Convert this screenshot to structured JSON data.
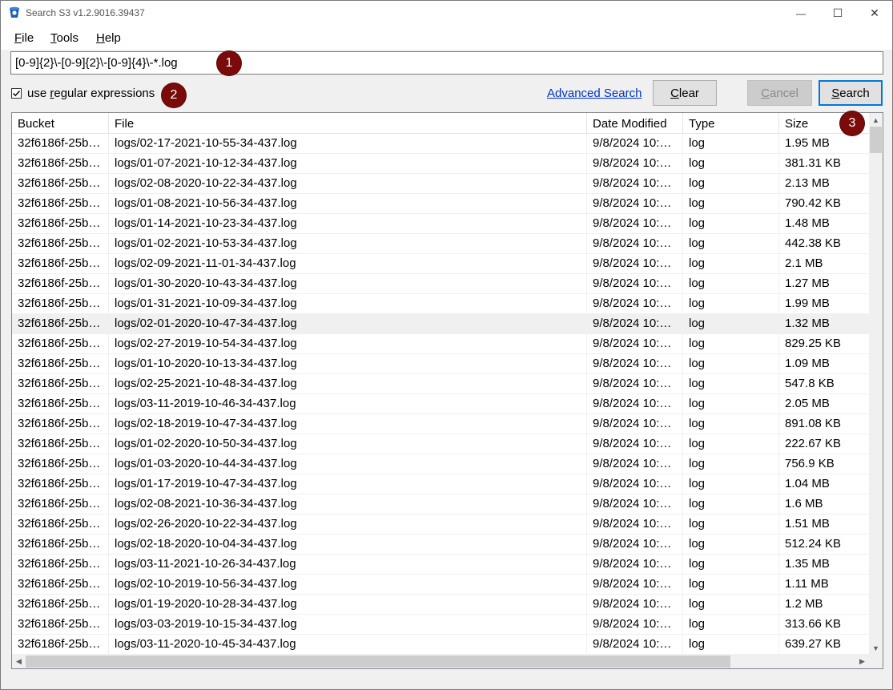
{
  "window": {
    "title": "Search S3 v1.2.9016.39437",
    "minimize_glyph": "—",
    "maximize_glyph": "☐",
    "close_glyph": "✕"
  },
  "menu": {
    "file_u": "F",
    "file_rest": "ile",
    "tools_u": "T",
    "tools_rest": "ools",
    "help_u": "H",
    "help_rest": "elp"
  },
  "search": {
    "query": "[0-9]{2}\\-[0-9]{2}\\-[0-9]{4}\\-*.log"
  },
  "badges": {
    "one": "1",
    "two": "2",
    "three": "3"
  },
  "options": {
    "regex_checked": true,
    "regex_label_pre": "use ",
    "regex_label_u": "r",
    "regex_label_post": "egular expressions",
    "advanced_link": "Advanced Search"
  },
  "buttons": {
    "clear_u": "C",
    "clear_rest": "lear",
    "cancel_u": "C",
    "cancel_rest": "ancel",
    "search_u": "S",
    "search_rest": "earch"
  },
  "table": {
    "columns": [
      "Bucket",
      "File",
      "Date Modified",
      "Type",
      "Size"
    ],
    "highlight_row": 9,
    "rows": [
      [
        "32f6186f-25b…",
        "logs/02-17-2021-10-55-34-437.log",
        "9/8/2024 10:…",
        "log",
        "1.95 MB"
      ],
      [
        "32f6186f-25b…",
        "logs/01-07-2021-10-12-34-437.log",
        "9/8/2024 10:…",
        "log",
        "381.31 KB"
      ],
      [
        "32f6186f-25b…",
        "logs/02-08-2020-10-22-34-437.log",
        "9/8/2024 10:…",
        "log",
        "2.13 MB"
      ],
      [
        "32f6186f-25b…",
        "logs/01-08-2021-10-56-34-437.log",
        "9/8/2024 10:…",
        "log",
        "790.42 KB"
      ],
      [
        "32f6186f-25b…",
        "logs/01-14-2021-10-23-34-437.log",
        "9/8/2024 10:…",
        "log",
        "1.48 MB"
      ],
      [
        "32f6186f-25b…",
        "logs/01-02-2021-10-53-34-437.log",
        "9/8/2024 10:…",
        "log",
        "442.38 KB"
      ],
      [
        "32f6186f-25b…",
        "logs/02-09-2021-11-01-34-437.log",
        "9/8/2024 10:…",
        "log",
        "2.1 MB"
      ],
      [
        "32f6186f-25b…",
        "logs/01-30-2020-10-43-34-437.log",
        "9/8/2024 10:…",
        "log",
        "1.27 MB"
      ],
      [
        "32f6186f-25b…",
        "logs/01-31-2021-10-09-34-437.log",
        "9/8/2024 10:…",
        "log",
        "1.99 MB"
      ],
      [
        "32f6186f-25b…",
        "logs/02-01-2020-10-47-34-437.log",
        "9/8/2024 10:…",
        "log",
        "1.32 MB"
      ],
      [
        "32f6186f-25b…",
        "logs/02-27-2019-10-54-34-437.log",
        "9/8/2024 10:…",
        "log",
        "829.25 KB"
      ],
      [
        "32f6186f-25b…",
        "logs/01-10-2020-10-13-34-437.log",
        "9/8/2024 10:…",
        "log",
        "1.09 MB"
      ],
      [
        "32f6186f-25b…",
        "logs/02-25-2021-10-48-34-437.log",
        "9/8/2024 10:…",
        "log",
        "547.8 KB"
      ],
      [
        "32f6186f-25b…",
        "logs/03-11-2019-10-46-34-437.log",
        "9/8/2024 10:…",
        "log",
        "2.05 MB"
      ],
      [
        "32f6186f-25b…",
        "logs/02-18-2019-10-47-34-437.log",
        "9/8/2024 10:…",
        "log",
        "891.08 KB"
      ],
      [
        "32f6186f-25b…",
        "logs/01-02-2020-10-50-34-437.log",
        "9/8/2024 10:…",
        "log",
        "222.67 KB"
      ],
      [
        "32f6186f-25b…",
        "logs/01-03-2020-10-44-34-437.log",
        "9/8/2024 10:…",
        "log",
        "756.9 KB"
      ],
      [
        "32f6186f-25b…",
        "logs/01-17-2019-10-47-34-437.log",
        "9/8/2024 10:…",
        "log",
        "1.04 MB"
      ],
      [
        "32f6186f-25b…",
        "logs/02-08-2021-10-36-34-437.log",
        "9/8/2024 10:…",
        "log",
        "1.6 MB"
      ],
      [
        "32f6186f-25b…",
        "logs/02-26-2020-10-22-34-437.log",
        "9/8/2024 10:…",
        "log",
        "1.51 MB"
      ],
      [
        "32f6186f-25b…",
        "logs/02-18-2020-10-04-34-437.log",
        "9/8/2024 10:…",
        "log",
        "512.24 KB"
      ],
      [
        "32f6186f-25b…",
        "logs/03-11-2021-10-26-34-437.log",
        "9/8/2024 10:…",
        "log",
        "1.35 MB"
      ],
      [
        "32f6186f-25b…",
        "logs/02-10-2019-10-56-34-437.log",
        "9/8/2024 10:…",
        "log",
        "1.11 MB"
      ],
      [
        "32f6186f-25b…",
        "logs/01-19-2020-10-28-34-437.log",
        "9/8/2024 10:…",
        "log",
        "1.2 MB"
      ],
      [
        "32f6186f-25b…",
        "logs/03-03-2019-10-15-34-437.log",
        "9/8/2024 10:…",
        "log",
        "313.66 KB"
      ],
      [
        "32f6186f-25b…",
        "logs/03-11-2020-10-45-34-437.log",
        "9/8/2024 10:…",
        "log",
        "639.27 KB"
      ]
    ]
  },
  "scrollbars": {
    "up_glyph": "▲",
    "down_glyph": "▼",
    "left_glyph": "◀",
    "right_glyph": "▶"
  },
  "colors": {
    "badge": "#7b0a0a",
    "link": "#0033cc",
    "focus_border": "#0078d7",
    "row_highlight": "#f0f0f0"
  }
}
